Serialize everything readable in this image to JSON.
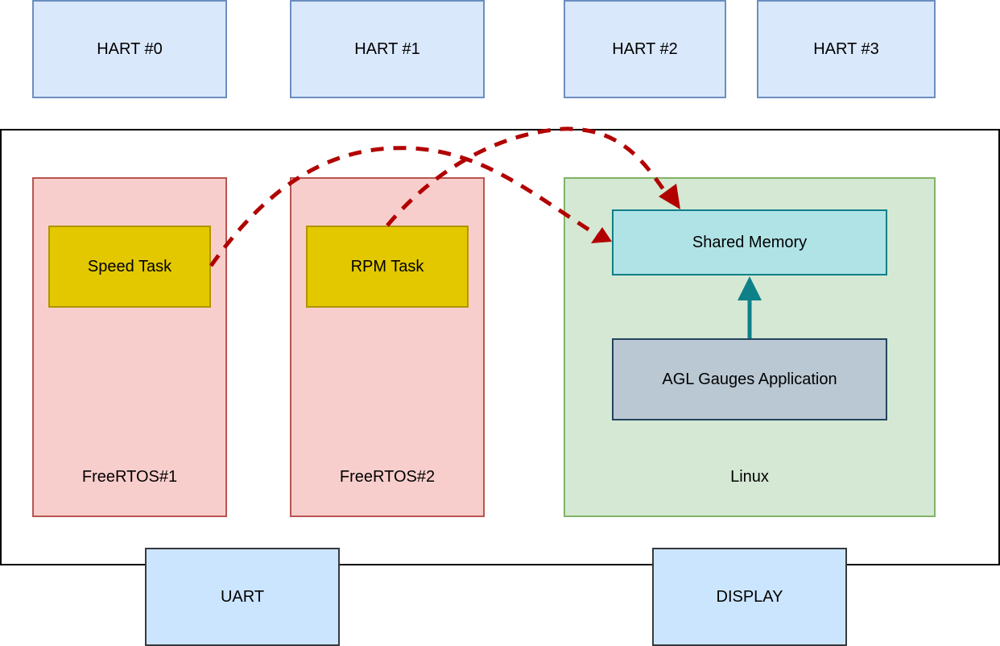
{
  "harts": [
    {
      "label": "HART #0"
    },
    {
      "label": "HART #1"
    },
    {
      "label": "HART #2"
    },
    {
      "label": "HART #3"
    }
  ],
  "domains": {
    "freertos1": {
      "label": "FreeRTOS#1",
      "task": "Speed Task"
    },
    "freertos2": {
      "label": "FreeRTOS#2",
      "task": "RPM Task"
    },
    "linux": {
      "label": "Linux",
      "shared_memory": "Shared Memory",
      "app": "AGL Gauges Application"
    }
  },
  "peripherals": [
    {
      "label": "UART"
    },
    {
      "label": "DISPLAY"
    }
  ],
  "connections": [
    {
      "from": "Speed Task",
      "to": "Shared Memory",
      "style": "dashed",
      "color": "#b20000"
    },
    {
      "from": "RPM Task",
      "to": "Shared Memory",
      "style": "dashed",
      "color": "#b20000"
    },
    {
      "from": "AGL Gauges Application",
      "to": "Shared Memory",
      "style": "solid",
      "color": "#0e8088"
    }
  ],
  "colors": {
    "hart_fill": "#dae8fc",
    "freertos_fill": "#f8cecc",
    "linux_fill": "#d5e8d4",
    "task_fill": "#e3c800",
    "shared_memory_fill": "#b0e3e6",
    "app_fill": "#bac8d3",
    "peripheral_fill": "#cce5ff"
  }
}
